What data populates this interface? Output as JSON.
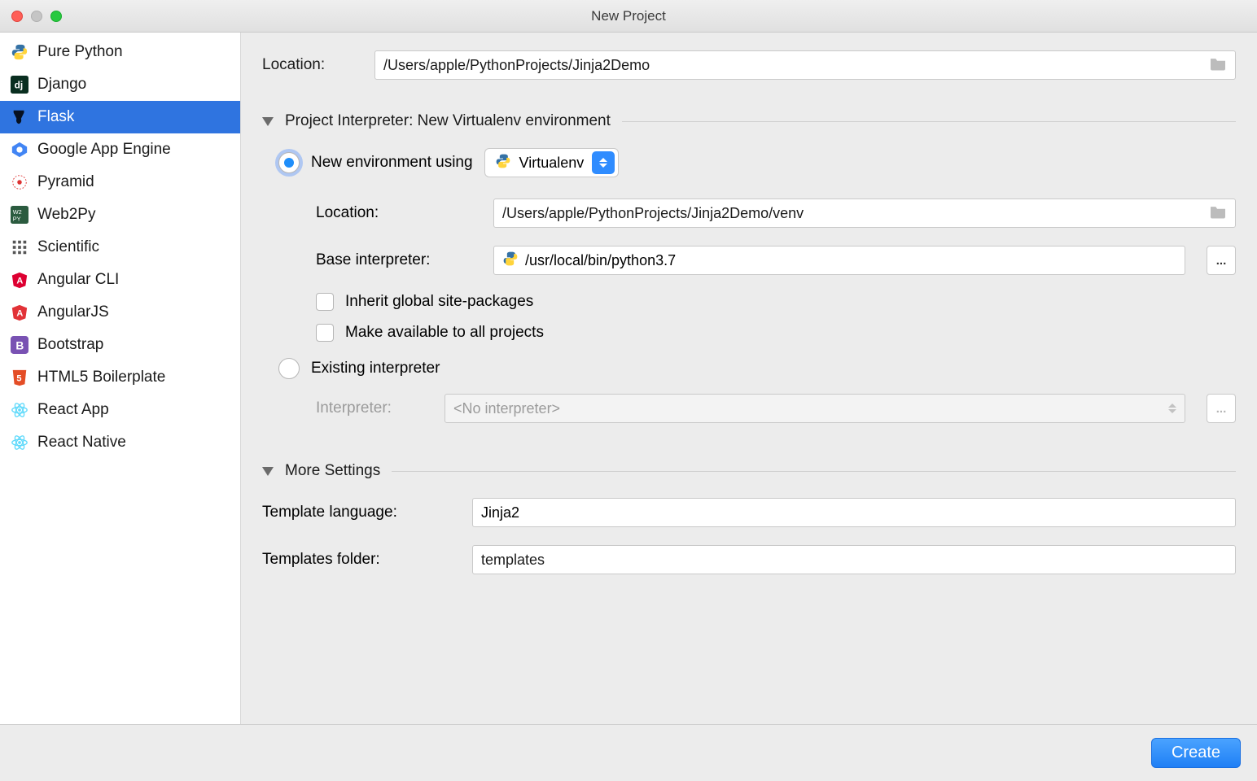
{
  "window": {
    "title": "New Project"
  },
  "sidebar": {
    "items": [
      {
        "label": "Pure Python"
      },
      {
        "label": "Django"
      },
      {
        "label": "Flask"
      },
      {
        "label": "Google App Engine"
      },
      {
        "label": "Pyramid"
      },
      {
        "label": "Web2Py"
      },
      {
        "label": "Scientific"
      },
      {
        "label": "Angular CLI"
      },
      {
        "label": "AngularJS"
      },
      {
        "label": "Bootstrap"
      },
      {
        "label": "HTML5 Boilerplate"
      },
      {
        "label": "React App"
      },
      {
        "label": "React Native"
      }
    ],
    "selected_index": 2
  },
  "form": {
    "location_label": "Location:",
    "location_value": "/Users/apple/PythonProjects/Jinja2Demo",
    "interpreter_section": "Project Interpreter: New Virtualenv environment",
    "new_env_label": "New environment using",
    "new_env_tool": "Virtualenv",
    "env_location_label": "Location:",
    "env_location_value": "/Users/apple/PythonProjects/Jinja2Demo/venv",
    "base_interpreter_label": "Base interpreter:",
    "base_interpreter_value": "/usr/local/bin/python3.7",
    "inherit_label": "Inherit global site-packages",
    "make_available_label": "Make available to all projects",
    "existing_label": "Existing interpreter",
    "interpreter_label": "Interpreter:",
    "interpreter_value": "<No interpreter>",
    "more_settings": "More Settings",
    "template_lang_label": "Template language:",
    "template_lang_value": "Jinja2",
    "templates_folder_label": "Templates folder:",
    "templates_folder_value": "templates"
  },
  "footer": {
    "create": "Create"
  },
  "ellipsis": "..."
}
